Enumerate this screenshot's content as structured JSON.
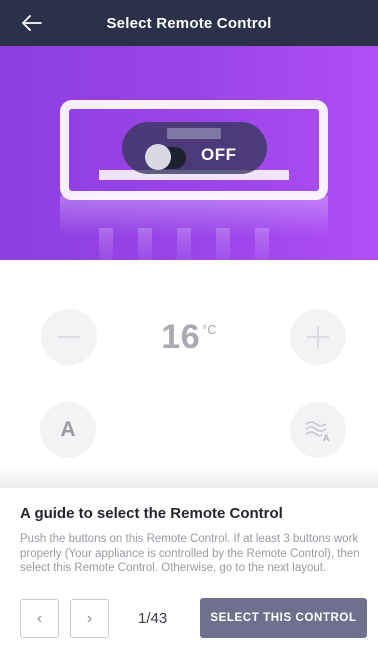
{
  "header": {
    "title": "Select Remote Control",
    "back_icon": "arrow-left-icon"
  },
  "hero": {
    "power_state_label": "OFF",
    "gradient_colors": [
      "#8d3ee0",
      "#b04ef6"
    ],
    "remote_icon": "remote-control-icon"
  },
  "controls": {
    "temperature": "16",
    "temperature_unit": "°C",
    "minus_icon": "minus-icon",
    "plus_icon": "plus-icon",
    "mode_label": "A",
    "fan_icon": "fan-auto-icon"
  },
  "guide": {
    "title": "A guide to select the Remote Control",
    "text": "Push the buttons on this Remote Control. If at least 3 buttons work properly (Your appliance is controlled by the Remote Control), then select this Remote Control. Otherwise, go to the next layout.",
    "prev_label": "‹",
    "next_label": "›",
    "page_indicator": "1/43",
    "select_label": "SELECT THIS CONTROL"
  },
  "colors": {
    "header_bg": "#2b3148",
    "select_button_bg": "#6f708d",
    "muted_text": "#9a9aa4"
  }
}
